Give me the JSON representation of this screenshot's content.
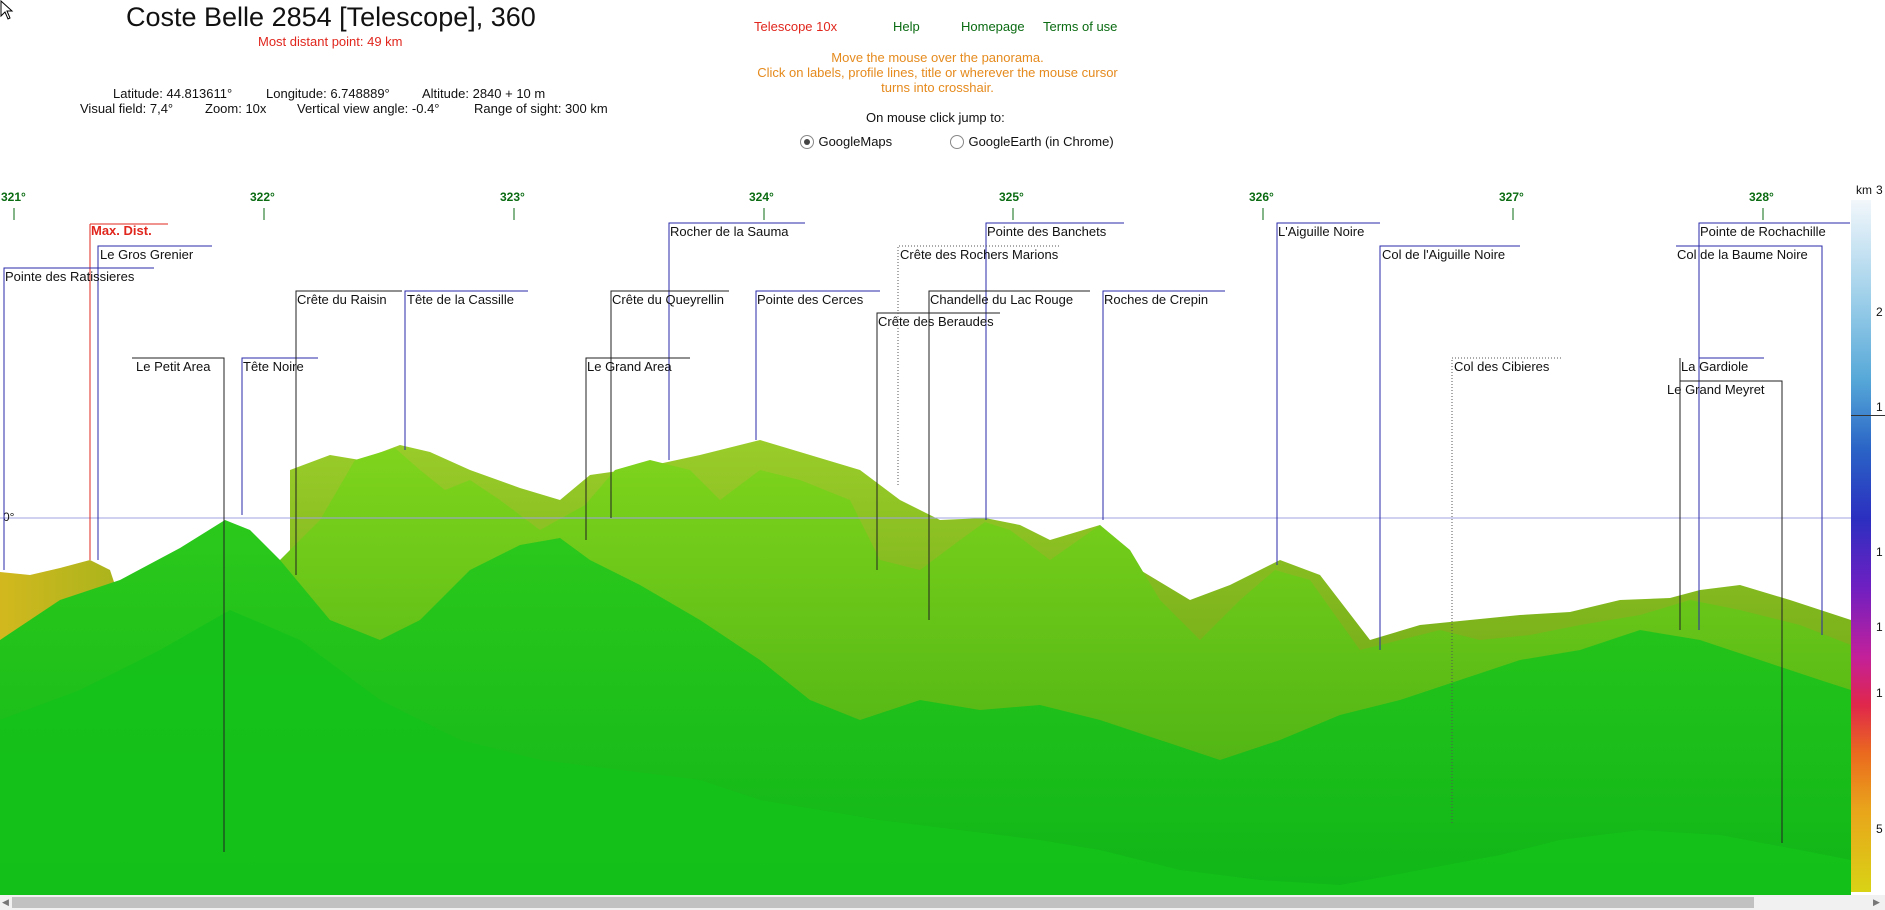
{
  "header": {
    "title": "Coste Belle 2854 [Telescope], 360",
    "most_distant": "Most distant point: 49 km",
    "latitude": "Latitude: 44.813611°",
    "longitude": "Longitude: 6.748889°",
    "altitude": "Altitude: 2840 + 10 m",
    "visual_field": "Visual field: 7,4°",
    "zoom": "Zoom: 10x",
    "vertical_angle": "Vertical view angle: -0.4°",
    "range": "Range of sight: 300 km"
  },
  "toplinks": {
    "telescope": "Telescope 10x",
    "help": "Help",
    "homepage": "Homepage",
    "terms": "Terms of use"
  },
  "instructions": {
    "line1": "Move the mouse over the panorama.",
    "line2": "Click on labels, profile lines, title or wherever the mouse cursor turns into crosshair."
  },
  "jump": {
    "label": "On mouse click jump to:",
    "option1": "GoogleMaps",
    "option2": "GoogleEarth (in Chrome)",
    "selected": "GoogleMaps"
  },
  "panorama": {
    "degree_ticks": [
      "321°",
      "322°",
      "323°",
      "324°",
      "325°",
      "326°",
      "327°",
      "328°"
    ],
    "horizon_label": "0°",
    "max_dist_label": "Max. Dist.",
    "peaks": {
      "pointe_ratissieres": "Pointe des Ratissieres",
      "gros_grenier": "Le Gros Grenier",
      "petit_area": "Le Petit Area",
      "tete_noire": "Tête Noire",
      "crete_raisin": "Crête du Raisin",
      "tete_cassille": "Tête de la Cassille",
      "grand_area": "Le Grand Area",
      "crete_queyrellin": "Crête du Queyrellin",
      "rocher_sauma": "Rocher de la Sauma",
      "pointe_cerces": "Pointe des Cerces",
      "crete_beraudes": "Crête des Beraudes",
      "crete_rochers_marions": "Crête des Rochers Marions",
      "chandelle_lac_rouge": "Chandelle du Lac Rouge",
      "pointe_banchets": "Pointe des Banchets",
      "roches_crepin": "Roches de Crepin",
      "aiguille_noire": "L'Aiguille Noire",
      "col_aiguille_noire": "Col de l'Aiguille Noire",
      "col_cibieres": "Col des Cibieres",
      "col_baume_noire": "Col de la Baume Noire",
      "pointe_rochachille": "Pointe de Rochachille",
      "la_gardiole": "La Gardiole",
      "grand_meyret": "Le Grand Meyret"
    }
  },
  "colorbar": {
    "unit": "km",
    "labels": [
      "3",
      "2",
      "1",
      "1",
      "1",
      "1",
      "5"
    ]
  },
  "colors": {
    "title": "#111111",
    "distant": "#e0261d",
    "telescope_link": "#e0261d",
    "green_link": "#0a6b12",
    "instructions": "#e58a1d",
    "label_line": "#2a2aa8",
    "max_dist_line": "#e0261d",
    "terrain_far": "#8dbf1a",
    "terrain_near": "#18c81a"
  }
}
